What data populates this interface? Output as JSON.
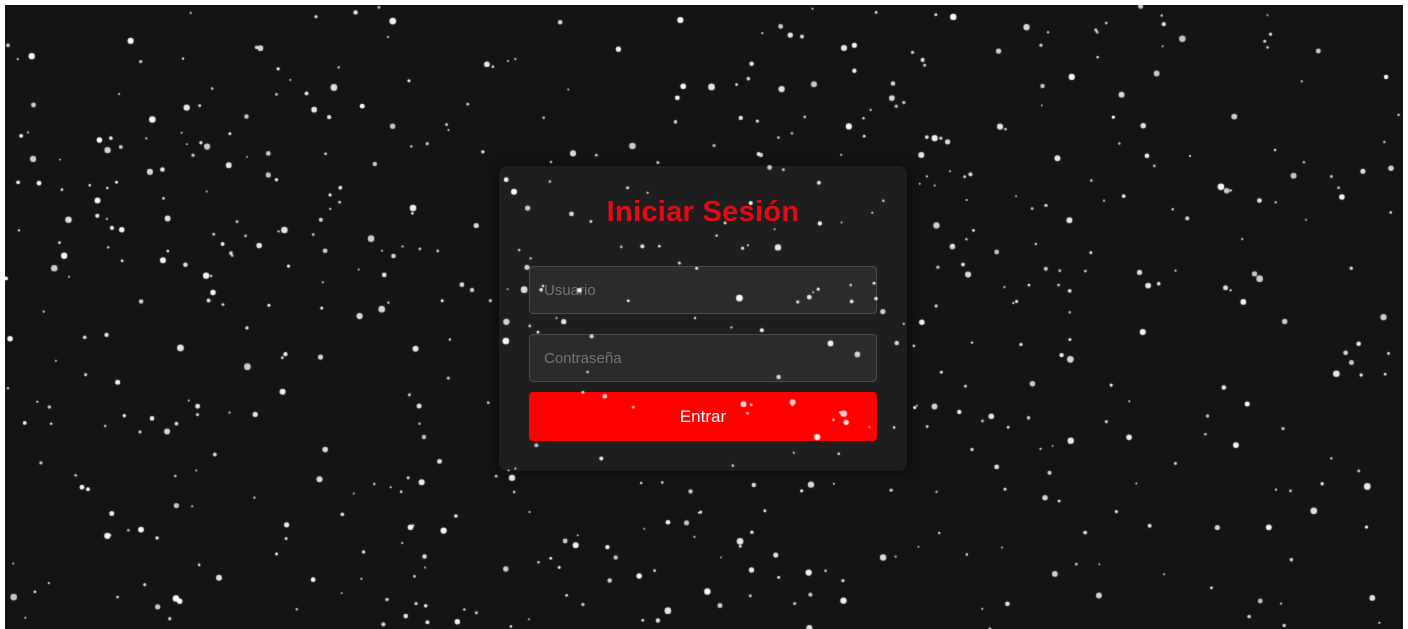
{
  "login": {
    "title": "Iniciar Sesión",
    "username_placeholder": "Usuario",
    "password_placeholder": "Contraseña",
    "username_value": "",
    "password_value": "",
    "submit_label": "Entrar"
  },
  "colors": {
    "background": "#141414",
    "card": "#1e1e1e",
    "accent": "#e50914",
    "button": "#ff0000",
    "star": "#ffffff"
  },
  "background_effect": "falling-snow-particles"
}
